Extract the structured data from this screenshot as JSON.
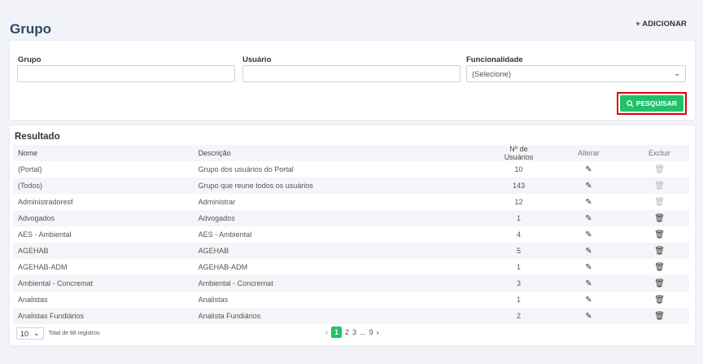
{
  "header": {
    "title": "Grupo",
    "add_label": "+ ADICIONAR"
  },
  "filters": {
    "grupo_label": "Grupo",
    "usuario_label": "Usuário",
    "funcionalidade_label": "Funcionalidade",
    "funcionalidade_value": "(Selecione)",
    "search_label": "PESQUISAR"
  },
  "results": {
    "title": "Resultado",
    "columns": [
      "Nome",
      "Descrição",
      "Nº de Usuários",
      "Alterar",
      "Excluir"
    ],
    "rows": [
      {
        "nome": "(Portal)",
        "descricao": "Grupo dos usuários do Portal",
        "usuarios": "10",
        "delete_enabled": false
      },
      {
        "nome": "(Todos)",
        "descricao": "Grupo que reune todos os usuários",
        "usuarios": "143",
        "delete_enabled": false
      },
      {
        "nome": "Administradoresf",
        "descricao": "Administrar",
        "usuarios": "12",
        "delete_enabled": false
      },
      {
        "nome": "Advogados",
        "descricao": "Advogados",
        "usuarios": "1",
        "delete_enabled": true
      },
      {
        "nome": "AES - Ambiental",
        "descricao": "AES - Ambiental",
        "usuarios": "4",
        "delete_enabled": true
      },
      {
        "nome": "AGEHAB",
        "descricao": "AGEHAB",
        "usuarios": "5",
        "delete_enabled": true
      },
      {
        "nome": "AGEHAB-ADM",
        "descricao": "AGEHAB-ADM",
        "usuarios": "1",
        "delete_enabled": true
      },
      {
        "nome": "Ambiental - Concremat",
        "descricao": "Ambiental - Concremat",
        "usuarios": "3",
        "delete_enabled": true
      },
      {
        "nome": "Analistas",
        "descricao": "Analistas",
        "usuarios": "1",
        "delete_enabled": true
      },
      {
        "nome": "Analistas Fundiários",
        "descricao": "Analista Fundiários",
        "usuarios": "2",
        "delete_enabled": true
      }
    ]
  },
  "footer": {
    "page_size": "10",
    "total_text": "Total de 88 registros",
    "pages": [
      "1",
      "2",
      "3",
      "...",
      "9"
    ],
    "active_page": "1"
  },
  "icons": {
    "edit": "edit-icon",
    "delete": "trash-icon",
    "search": "search-icon"
  },
  "colors": {
    "accent": "#21c16b",
    "title": "#2d4a6b",
    "highlight": "#e00000"
  }
}
